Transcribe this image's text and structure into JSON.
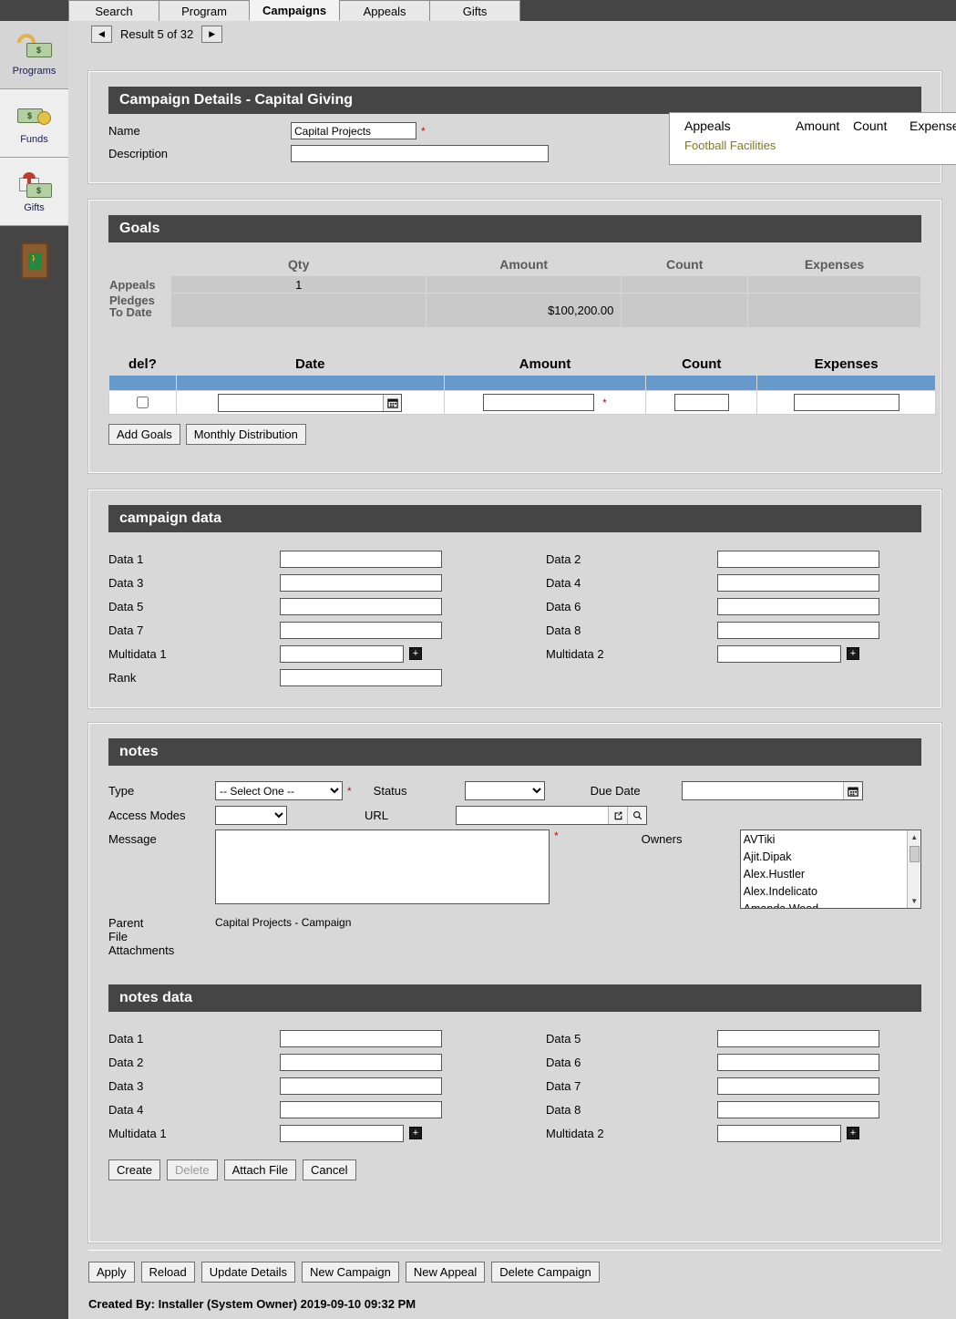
{
  "tabs": [
    {
      "label": "Search",
      "active": false
    },
    {
      "label": "Program",
      "active": false
    },
    {
      "label": "Campaigns",
      "active": true
    },
    {
      "label": "Appeals",
      "active": false
    },
    {
      "label": "Gifts",
      "active": false
    }
  ],
  "sidebar": {
    "items": [
      {
        "label": "Programs",
        "icon": "programs-icon"
      },
      {
        "label": "Funds",
        "icon": "funds-icon"
      },
      {
        "label": "Gifts",
        "icon": "gifts-icon"
      }
    ],
    "exit": {
      "icon": "exit-door-icon"
    }
  },
  "result_nav": {
    "prev_icon": "◀",
    "next_icon": "▶",
    "text": "Result 5 of 32"
  },
  "details": {
    "title": "Campaign Details - Capital Giving",
    "name_label": "Name",
    "name_value": "Capital Projects",
    "name_required": "*",
    "description_label": "Description",
    "description_value": "",
    "appeals_box": {
      "appeals_label": "Appeals",
      "amount_label": "Amount",
      "count_label": "Count",
      "expenses_label": "Expenses",
      "appeal_name": "Football Facilities",
      "link_color": "#7d7a22"
    }
  },
  "goals": {
    "title": "Goals",
    "summary": {
      "headers": [
        "",
        "Qty",
        "Amount",
        "Count",
        "Expenses"
      ],
      "rows": [
        {
          "label": "Appeals",
          "qty": "1",
          "amount": "",
          "count": "",
          "expenses": ""
        },
        {
          "label": "Pledges\nTo Date",
          "qty": "",
          "amount": "$100,200.00",
          "count": "",
          "expenses": ""
        }
      ],
      "row_labels": [
        "Appeals",
        "Pledges",
        "To Date"
      ]
    },
    "table": {
      "headers": [
        "del?",
        "Date",
        "Amount",
        "Count",
        "Expenses"
      ],
      "row": {
        "del_checked": false,
        "date_value": "",
        "amount_value": "",
        "amount_required": "*",
        "count_value": "",
        "expenses_value": "",
        "calendar_icon": "calendar-icon"
      }
    },
    "buttons": [
      {
        "label": "Add Goals"
      },
      {
        "label": "Monthly Distribution"
      }
    ]
  },
  "campaign_data": {
    "title": "campaign data",
    "left": [
      {
        "label": "Data 1",
        "value": ""
      },
      {
        "label": "Data 3",
        "value": ""
      },
      {
        "label": "Data 5",
        "value": ""
      },
      {
        "label": "Data 7",
        "value": ""
      },
      {
        "label": "Multidata 1",
        "value": "",
        "multi": true
      },
      {
        "label": "Rank",
        "value": ""
      }
    ],
    "right": [
      {
        "label": "Data 2",
        "value": ""
      },
      {
        "label": "Data 4",
        "value": ""
      },
      {
        "label": "Data 6",
        "value": ""
      },
      {
        "label": "Data 8",
        "value": ""
      },
      {
        "label": "Multidata 2",
        "value": "",
        "multi": true
      }
    ]
  },
  "notes": {
    "title": "notes",
    "type_label": "Type",
    "type_value": "-- Select One --",
    "type_required": "*",
    "status_label": "Status",
    "status_value": "",
    "due_date_label": "Due Date",
    "due_date_value": "",
    "due_date_icon": "calendar-icon",
    "access_modes_label": "Access Modes",
    "access_modes_value": "",
    "url_label": "URL",
    "url_value": "",
    "url_icons": [
      "external-link-icon",
      "search-icon"
    ],
    "message_label": "Message",
    "message_value": "",
    "message_required": "*",
    "owners_label": "Owners",
    "owners": [
      "AVTiki",
      "Ajit.Dipak",
      "Alex.Hustler",
      "Alex.Indelicato",
      "Amanda.Wood"
    ],
    "parent_label": "Parent",
    "parent_value": "Capital Projects - Campaign",
    "file_label": "File",
    "attachments_label": "Attachments"
  },
  "notes_data": {
    "title": "notes data",
    "left": [
      {
        "label": "Data 1",
        "value": ""
      },
      {
        "label": "Data 2",
        "value": ""
      },
      {
        "label": "Data 3",
        "value": ""
      },
      {
        "label": "Data 4",
        "value": ""
      },
      {
        "label": "Multidata 1",
        "value": "",
        "multi": true
      }
    ],
    "right": [
      {
        "label": "Data 5",
        "value": ""
      },
      {
        "label": "Data 6",
        "value": ""
      },
      {
        "label": "Data 7",
        "value": ""
      },
      {
        "label": "Data 8",
        "value": ""
      },
      {
        "label": "Multidata 2",
        "value": "",
        "multi": true
      }
    ],
    "buttons": [
      {
        "label": "Create",
        "disabled": false
      },
      {
        "label": "Delete",
        "disabled": true
      },
      {
        "label": "Attach File",
        "disabled": false
      },
      {
        "label": "Cancel",
        "disabled": false
      }
    ]
  },
  "footer": {
    "buttons": [
      {
        "label": "Apply"
      },
      {
        "label": "Reload"
      },
      {
        "label": "Update Details"
      },
      {
        "label": "New Campaign"
      },
      {
        "label": "New Appeal"
      },
      {
        "label": "Delete Campaign"
      }
    ],
    "created_by": "Created By: Installer (System Owner) 2019-09-10 09:32 PM"
  },
  "colors": {
    "header_bar": "#454545",
    "blue_bar": "#6699cc",
    "page_bg": "#d8d8d8",
    "required": "#d00000"
  }
}
